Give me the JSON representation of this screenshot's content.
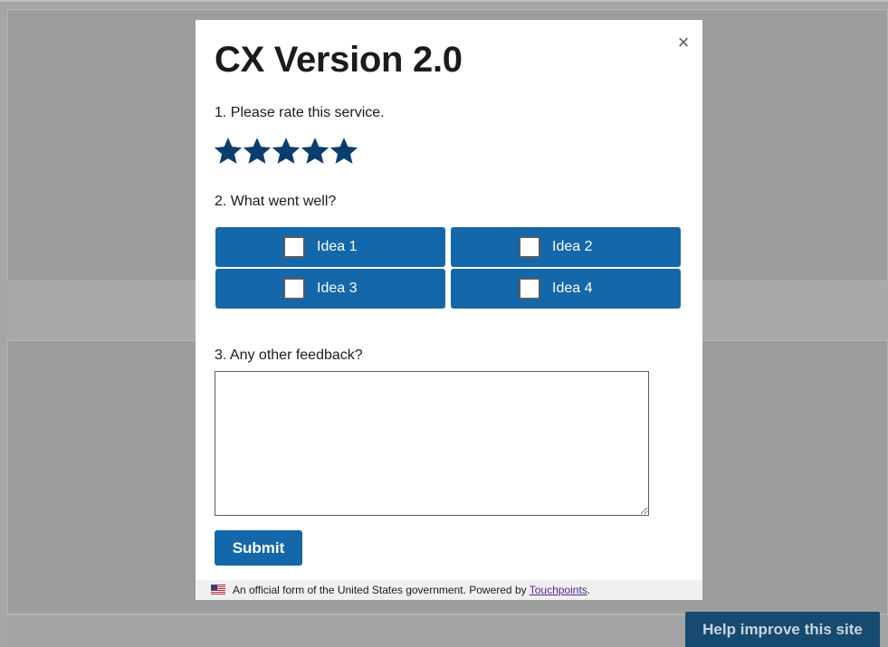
{
  "modal": {
    "close_symbol": "×",
    "title": "CX Version 2.0",
    "questions": [
      {
        "label": "1. Please rate this service."
      },
      {
        "label": "2. What went well?"
      },
      {
        "label": "3. Any other feedback?"
      }
    ],
    "rating": {
      "max_stars": 5,
      "selected_stars": 5,
      "star_color": "#0b3d6e"
    },
    "checkbox_options": [
      {
        "label": "Idea 1",
        "checked": false
      },
      {
        "label": "Idea 2",
        "checked": false
      },
      {
        "label": "Idea 3",
        "checked": false
      },
      {
        "label": "Idea 4",
        "checked": false
      }
    ],
    "feedback_value": "",
    "submit_label": "Submit",
    "footer": {
      "text": "An official form of the United States government. Powered by ",
      "link_text": "Touchpoints",
      "suffix": "."
    }
  },
  "help_tab_label": "Help improve this site",
  "colors": {
    "primary_button": "#1467a8",
    "help_tab": "#174a70",
    "overlay": "#a6a6a6"
  }
}
